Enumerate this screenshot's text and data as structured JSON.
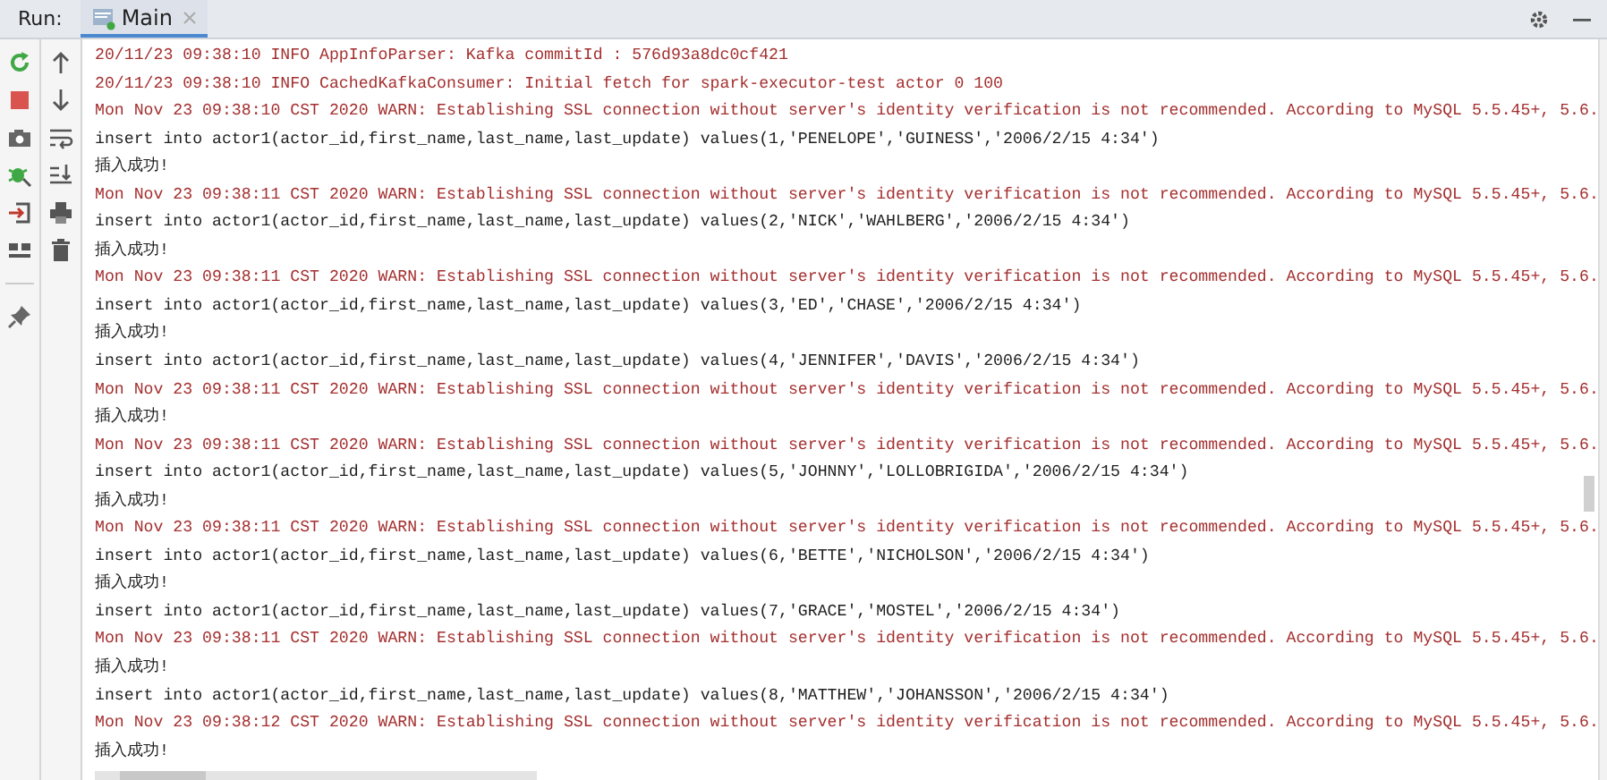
{
  "run_label": "Run:",
  "tabs": [
    {
      "label": "Main",
      "selected": true
    }
  ],
  "console": [
    {
      "kind": "info",
      "text": "20/11/23 09:38:10 INFO AppInfoParser: Kafka commitId : 576d93a8dc0cf421"
    },
    {
      "kind": "info",
      "text": "20/11/23 09:38:10 INFO CachedKafkaConsumer: Initial fetch for spark-executor-test actor 0 100"
    },
    {
      "kind": "warn",
      "text": "Mon Nov 23 09:38:10 CST 2020 WARN: Establishing SSL connection without server's identity verification is not recommended. According to MySQL 5.5.45+, 5.6."
    },
    {
      "kind": "out",
      "text": "insert into actor1(actor_id,first_name,last_name,last_update) values(1,'PENELOPE','GUINESS','2006/2/15 4:34')"
    },
    {
      "kind": "out",
      "text": "插入成功!"
    },
    {
      "kind": "warn",
      "text": "Mon Nov 23 09:38:11 CST 2020 WARN: Establishing SSL connection without server's identity verification is not recommended. According to MySQL 5.5.45+, 5.6."
    },
    {
      "kind": "out",
      "text": "insert into actor1(actor_id,first_name,last_name,last_update) values(2,'NICK','WAHLBERG','2006/2/15 4:34')"
    },
    {
      "kind": "out",
      "text": "插入成功!"
    },
    {
      "kind": "warn",
      "text": "Mon Nov 23 09:38:11 CST 2020 WARN: Establishing SSL connection without server's identity verification is not recommended. According to MySQL 5.5.45+, 5.6."
    },
    {
      "kind": "out",
      "text": "insert into actor1(actor_id,first_name,last_name,last_update) values(3,'ED','CHASE','2006/2/15 4:34')"
    },
    {
      "kind": "out",
      "text": "插入成功!"
    },
    {
      "kind": "out",
      "text": "insert into actor1(actor_id,first_name,last_name,last_update) values(4,'JENNIFER','DAVIS','2006/2/15 4:34')"
    },
    {
      "kind": "warn",
      "text": "Mon Nov 23 09:38:11 CST 2020 WARN: Establishing SSL connection without server's identity verification is not recommended. According to MySQL 5.5.45+, 5.6."
    },
    {
      "kind": "out",
      "text": "插入成功!"
    },
    {
      "kind": "warn",
      "text": "Mon Nov 23 09:38:11 CST 2020 WARN: Establishing SSL connection without server's identity verification is not recommended. According to MySQL 5.5.45+, 5.6."
    },
    {
      "kind": "out",
      "text": "insert into actor1(actor_id,first_name,last_name,last_update) values(5,'JOHNNY','LOLLOBRIGIDA','2006/2/15 4:34')"
    },
    {
      "kind": "out",
      "text": "插入成功!"
    },
    {
      "kind": "warn",
      "text": "Mon Nov 23 09:38:11 CST 2020 WARN: Establishing SSL connection without server's identity verification is not recommended. According to MySQL 5.5.45+, 5.6."
    },
    {
      "kind": "out",
      "text": "insert into actor1(actor_id,first_name,last_name,last_update) values(6,'BETTE','NICHOLSON','2006/2/15 4:34')"
    },
    {
      "kind": "out",
      "text": "插入成功!"
    },
    {
      "kind": "out",
      "text": "insert into actor1(actor_id,first_name,last_name,last_update) values(7,'GRACE','MOSTEL','2006/2/15 4:34')"
    },
    {
      "kind": "warn",
      "text": "Mon Nov 23 09:38:11 CST 2020 WARN: Establishing SSL connection without server's identity verification is not recommended. According to MySQL 5.5.45+, 5.6."
    },
    {
      "kind": "out",
      "text": "插入成功!"
    },
    {
      "kind": "out",
      "text": "insert into actor1(actor_id,first_name,last_name,last_update) values(8,'MATTHEW','JOHANSSON','2006/2/15 4:34')"
    },
    {
      "kind": "warn",
      "text": "Mon Nov 23 09:38:12 CST 2020 WARN: Establishing SSL connection without server's identity verification is not recommended. According to MySQL 5.5.45+, 5.6."
    },
    {
      "kind": "out",
      "text": "插入成功!"
    }
  ]
}
